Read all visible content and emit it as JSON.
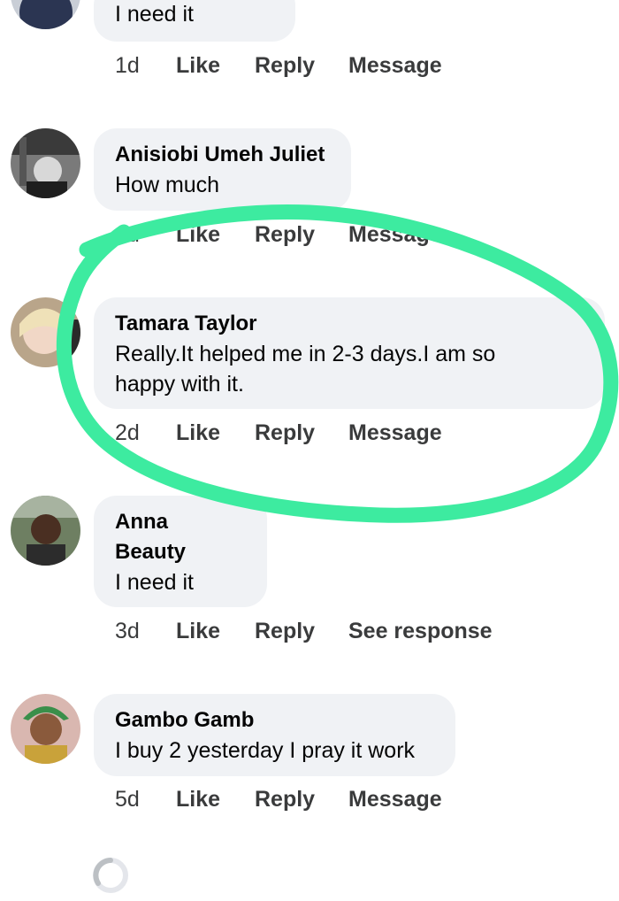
{
  "comments": [
    {
      "name": "",
      "text": "I need it",
      "time": "1d",
      "like": "Like",
      "reply": "Reply",
      "extra": "Message"
    },
    {
      "name": "Anisiobi Umeh Juliet",
      "text": "How much",
      "time": "1d",
      "like": "Like",
      "reply": "Reply",
      "extra": "Message"
    },
    {
      "name": "Tamara Taylor",
      "text_line1": "Really.It helped me in 2-3 days.I am so",
      "text_line2": "happy with it.",
      "time": "2d",
      "like": "Like",
      "reply": "Reply",
      "extra": "Message"
    },
    {
      "name_line1": "Anna",
      "name_line2": "Beauty",
      "text": "I need it",
      "time": "3d",
      "like": "Like",
      "reply": "Reply",
      "extra": "See response"
    },
    {
      "name": "Gambo Gamb",
      "text": "I buy 2 yesterday I pray it work",
      "time": "5d",
      "like": "Like",
      "reply": "Reply",
      "extra": "Message"
    }
  ],
  "annotation_color": "#3deba0",
  "bubble_color": "#f0f2f5"
}
